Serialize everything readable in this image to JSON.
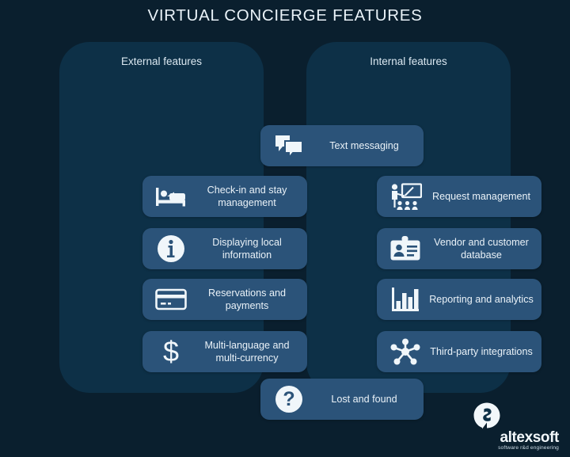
{
  "title": "VIRTUAL CONCIERGE FEATURES",
  "colors": {
    "background": "#0a1f2e",
    "panel": "#0d3047",
    "card": "#2b5379",
    "text": "#eaf2f8",
    "icon": "#f0f6fa"
  },
  "columns": [
    {
      "heading": "External features"
    },
    {
      "heading": "Internal features"
    }
  ],
  "bridge_cards": [
    {
      "label": "Text messaging",
      "icon": "chat-bubbles-icon"
    },
    {
      "label": "Lost and found",
      "icon": "question-mark-circle-icon"
    }
  ],
  "external_features": [
    {
      "label": "Check-in and stay management",
      "icon": "bed-icon"
    },
    {
      "label": "Displaying local information",
      "icon": "info-circle-icon"
    },
    {
      "label": "Reservations and payments",
      "icon": "credit-card-icon"
    },
    {
      "label": "Multi-language and multi-currency",
      "icon": "dollar-sign-icon"
    }
  ],
  "internal_features": [
    {
      "label": "Request management",
      "icon": "presenter-whiteboard-icon"
    },
    {
      "label": "Vendor and customer database",
      "icon": "id-badge-icon"
    },
    {
      "label": "Reporting and analytics",
      "icon": "bar-chart-icon"
    },
    {
      "label": "Third-party integrations",
      "icon": "network-hub-icon"
    }
  ],
  "logo": {
    "name": "altexsoft",
    "tagline": "software r&d engineering",
    "mark": "altexsoft-logo-mark"
  }
}
